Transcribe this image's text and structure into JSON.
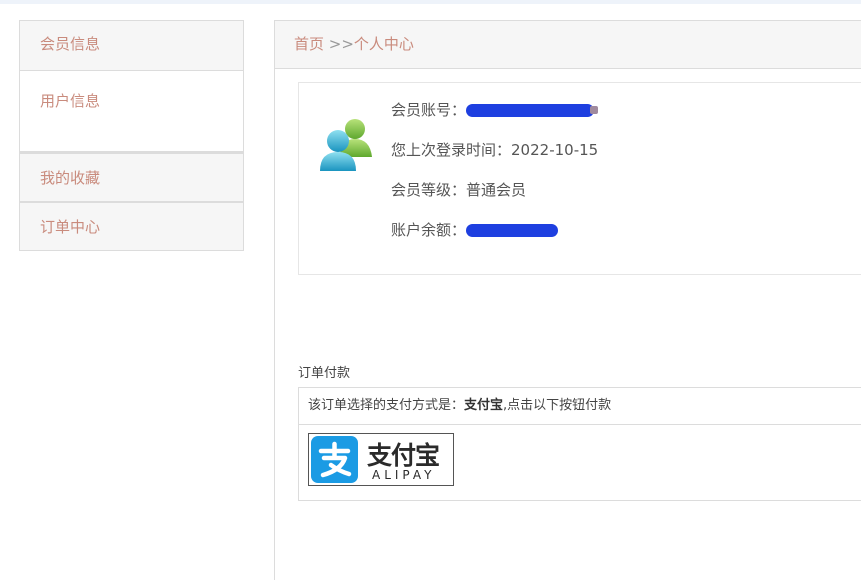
{
  "sidebar": {
    "section_title": "会员信息",
    "sub_item": "用户信息",
    "items": [
      "我的收藏",
      "订单中心"
    ]
  },
  "breadcrumb": {
    "home": "首页",
    "separator": " >>",
    "current": "个人中心"
  },
  "profile": {
    "account_label": "会员账号：",
    "last_login_label": "您上次登录时间：",
    "last_login_value": "2022-10-15",
    "level_label": "会员等级：",
    "level_value": "普通会员",
    "balance_label": "账户余额："
  },
  "payment": {
    "title": "订单付款",
    "desc_prefix": "该订单选择的支付方式是：",
    "method": "支付宝",
    "desc_suffix": ",点击以下按钮付款",
    "logo_cn": "支付宝",
    "logo_en": "ALIPAY"
  },
  "colors": {
    "link": "#c98b7d",
    "alipay_blue": "#1b9be4",
    "redaction": "#1e3fe0"
  }
}
